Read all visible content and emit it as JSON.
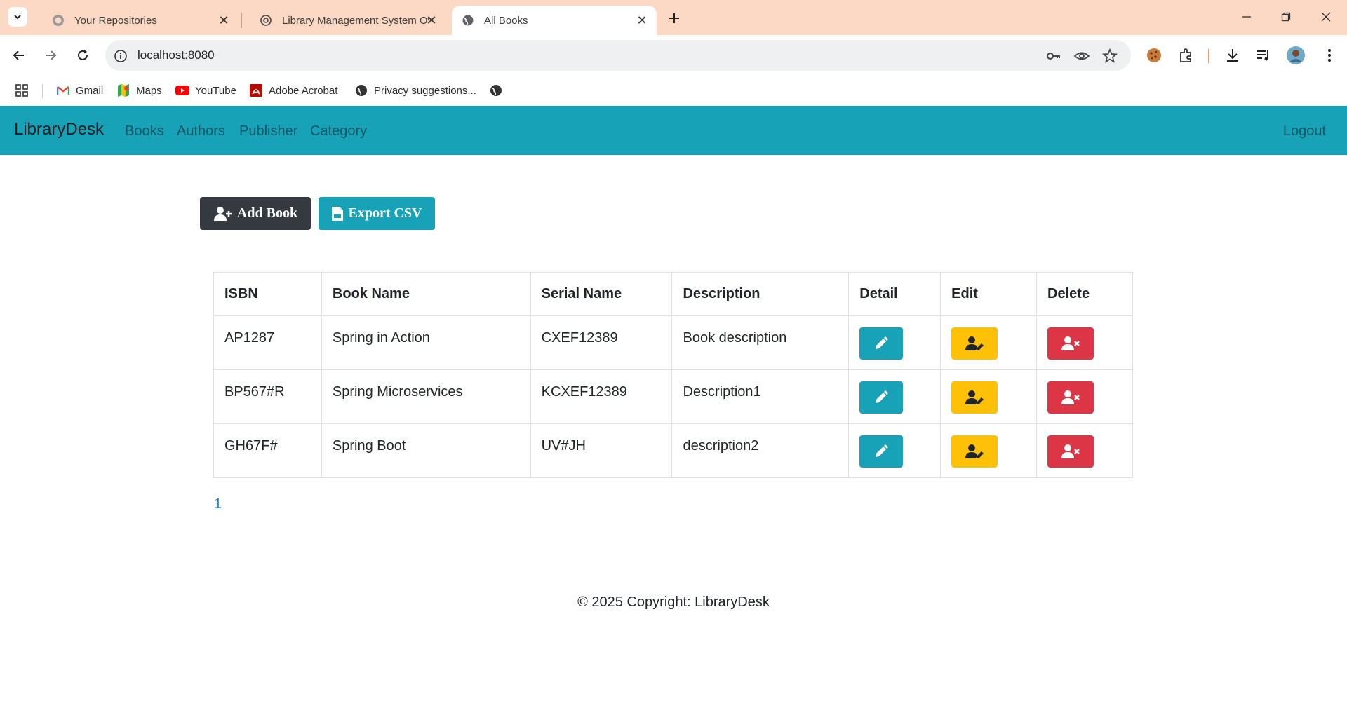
{
  "browser": {
    "tabs": [
      {
        "title": "Your Repositories",
        "icon": "github-icon",
        "active": false
      },
      {
        "title": "Library Management System Ov",
        "icon": "openai-icon",
        "active": false
      },
      {
        "title": "All Books",
        "icon": "globe-icon",
        "active": true
      }
    ],
    "url": "localhost:8080",
    "bookmarks": [
      {
        "label": "Gmail",
        "icon": "gmail-icon"
      },
      {
        "label": "Maps",
        "icon": "maps-icon"
      },
      {
        "label": "YouTube",
        "icon": "youtube-icon"
      },
      {
        "label": "Adobe Acrobat",
        "icon": "acrobat-icon"
      },
      {
        "label": "Privacy suggestions...",
        "icon": "privacy-icon"
      }
    ]
  },
  "navbar": {
    "brand": "LibraryDesk",
    "links": [
      "Books",
      "Authors",
      "Publisher",
      "Category"
    ],
    "logout": "Logout",
    "color": "#17a2b8"
  },
  "actions": {
    "add_book": "Add Book",
    "export_csv": "Export CSV"
  },
  "table": {
    "headers": [
      "ISBN",
      "Book Name",
      "Serial Name",
      "Description",
      "Detail",
      "Edit",
      "Delete"
    ],
    "rows": [
      {
        "isbn": "AP1287",
        "name": "Spring in Action",
        "serial": "CXEF12389",
        "description": "Book description"
      },
      {
        "isbn": "BP567#R",
        "name": "Spring Microservices",
        "serial": "KCXEF12389",
        "description": "Description1"
      },
      {
        "isbn": "GH67F#",
        "name": "Spring Boot",
        "serial": "UV#JH",
        "description": "description2"
      }
    ]
  },
  "pagination": {
    "page": "1"
  },
  "footer": {
    "text": "© 2025 Copyright: LibraryDesk"
  },
  "colors": {
    "info": "#17a2b8",
    "warning": "#ffc107",
    "danger": "#dc3545",
    "dark": "#343a40"
  }
}
